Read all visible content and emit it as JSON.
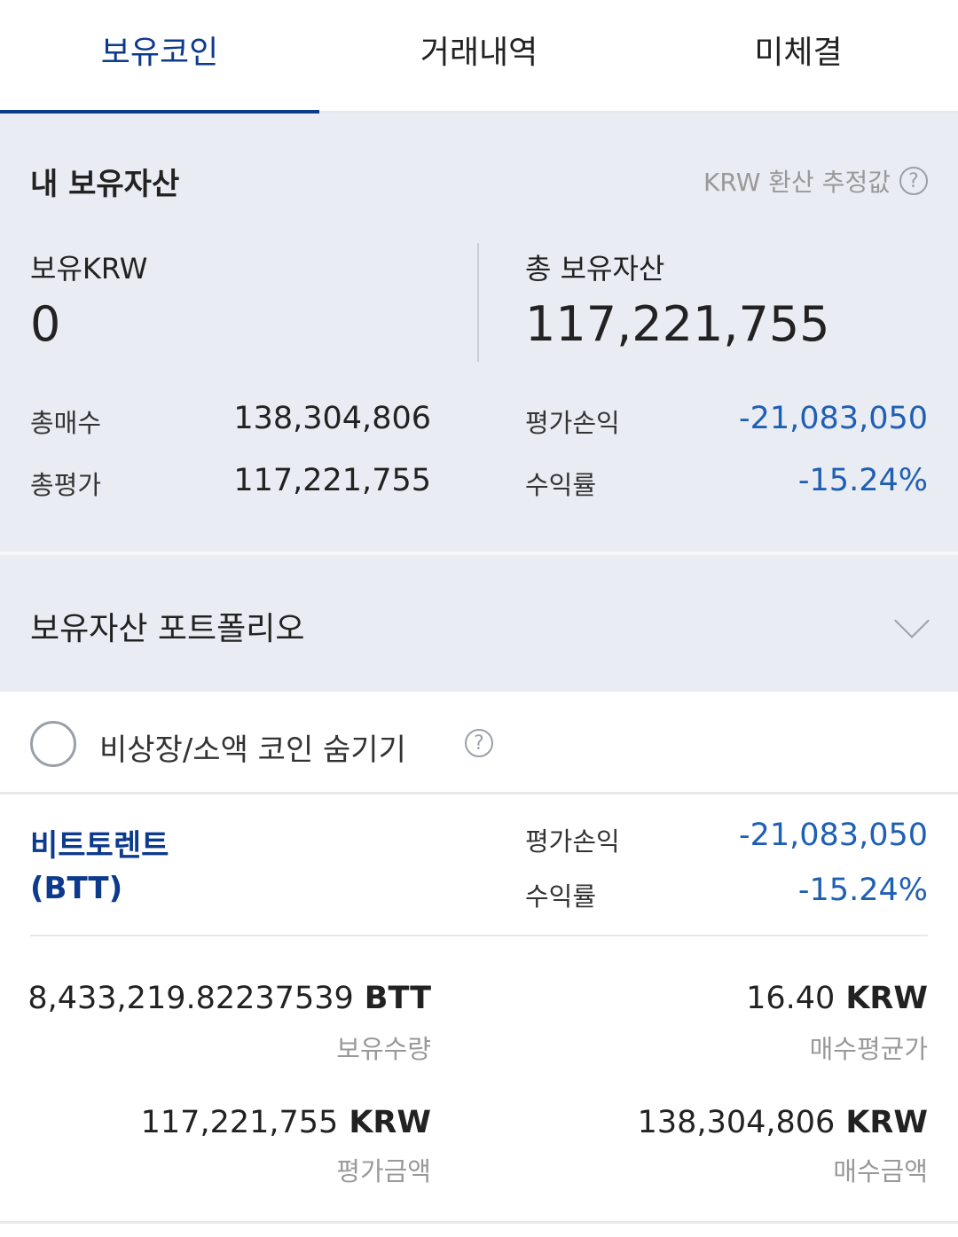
{
  "tabs": [
    "보유코인",
    "거래내역",
    "미체결"
  ],
  "summary": {
    "title": "내 보유자산",
    "krw_note": "KRW 환산 추정값",
    "help_glyph": "?",
    "holding_krw_label": "보유KRW",
    "holding_krw_value": "0",
    "total_assets_label": "총 보유자산",
    "total_assets_value": "117,221,755",
    "total_buy_label": "총매수",
    "total_buy_value": "138,304,806",
    "total_eval_label": "총평가",
    "total_eval_value": "117,221,755",
    "pnl_label": "평가손익",
    "pnl_value": "-21,083,050",
    "return_label": "수익률",
    "return_value": "-15.24%",
    "negative_color": "#1f5fb5"
  },
  "portfolio": {
    "title": "보유자산 포트폴리오"
  },
  "hide_option": {
    "label": "비상장/소액 코인 숨기기",
    "help_glyph": "?"
  },
  "coin": {
    "name": "비트토렌트",
    "ticker": "(BTT)",
    "pnl_label": "평가손익",
    "pnl_value": "-21,083,050",
    "return_label": "수익률",
    "return_value": "-15.24%",
    "quantity": "8,433,219.82237539",
    "quantity_unit": "BTT",
    "quantity_label": "보유수량",
    "avg_price": "16.40",
    "avg_price_unit": "KRW",
    "avg_price_label": "매수평균가",
    "eval_amount": "117,221,755",
    "eval_amount_unit": "KRW",
    "eval_amount_label": "평가금액",
    "buy_amount": "138,304,806",
    "buy_amount_unit": "KRW",
    "buy_amount_label": "매수금액"
  },
  "accent_color": "#0c3a8c"
}
